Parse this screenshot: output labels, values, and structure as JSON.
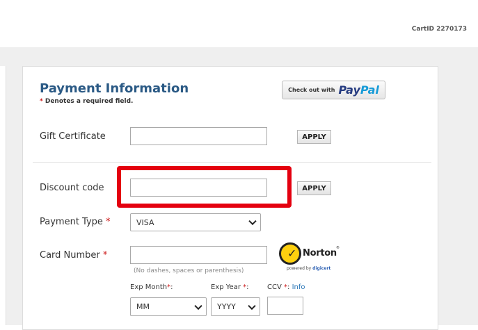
{
  "header": {
    "cart_id": "CartID 2270173"
  },
  "payment": {
    "title": "Payment Information",
    "required_star": "*",
    "required_text": " Denotes a required field."
  },
  "paypal": {
    "prefix": "Check out with",
    "logo_pay": "Pay",
    "logo_pal": "Pal"
  },
  "gift_certificate": {
    "label": "Gift Certificate",
    "value": "",
    "apply_label": "APPLY"
  },
  "discount_code": {
    "label": "Discount code",
    "value": "",
    "apply_label": "APPLY"
  },
  "payment_type": {
    "label": "Payment Type",
    "required_star": "*",
    "selected": "VISA"
  },
  "card_number": {
    "label": "Card Number",
    "required_star": "*",
    "value": "",
    "hint": "(No dashes, spaces or parenthesis)"
  },
  "exp_month": {
    "label": "Exp Month",
    "required_star": "*",
    "colon": ":",
    "selected": "MM"
  },
  "exp_year": {
    "label": "Exp Year",
    "required_star": "*",
    "colon": ":",
    "selected": "YYYY"
  },
  "ccv": {
    "label": "CCV",
    "required_star": "*",
    "colon": ":",
    "info_link": "Info",
    "value": ""
  },
  "norton": {
    "word": "Norton",
    "reg": "®",
    "powered_by": "powered by ",
    "digicert": "digicert",
    "check_glyph": "✓"
  },
  "colors": {
    "title_blue": "#2b5a85",
    "required_red": "#cc1a1a",
    "highlight_red": "#e4000f",
    "paypal_dark": "#253b80",
    "paypal_light": "#179bd7",
    "norton_yellow": "#fed00f",
    "link_blue": "#2b77b8",
    "page_gray": "#efefef"
  },
  "icons": {
    "select_arrow": "chevron-down-icon",
    "norton_badge": "norton-check-icon"
  }
}
